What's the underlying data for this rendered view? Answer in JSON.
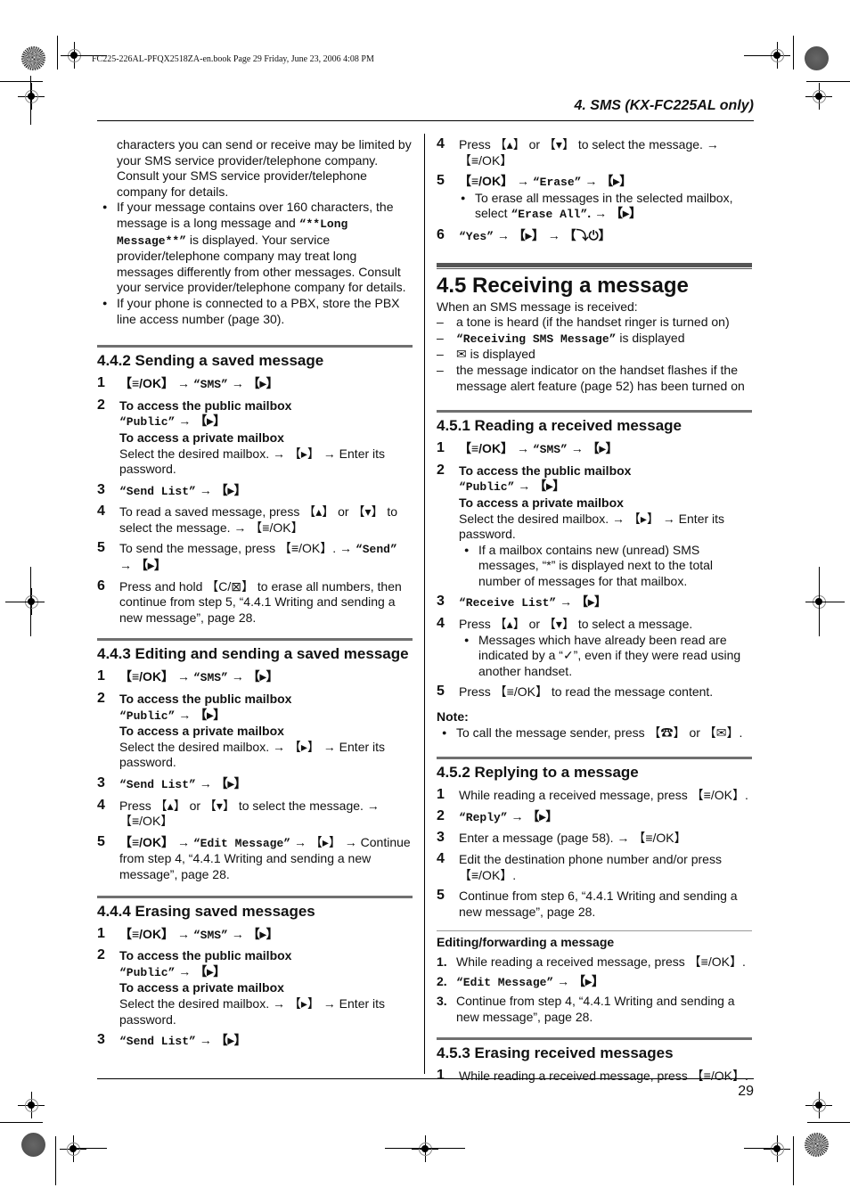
{
  "print_header": {
    "book_line": "FC225-226AL-PFQX2518ZA-en.book  Page 29  Friday, June 23, 2006  4:08 PM"
  },
  "running_header": {
    "title": "4. SMS (KX-FC225AL only)"
  },
  "footer": {
    "page_number": "29"
  },
  "icons": {
    "menu_ok": "menu-ok-key",
    "right": "right-key",
    "up": "up-key",
    "down": "down-key",
    "arrow": "arrow-right",
    "envelope": "envelope-icon",
    "off": "off-key",
    "talk": "talk-key",
    "speaker": "speakerphone-key",
    "clear": "clear-key"
  },
  "left": {
    "intro": {
      "para1": "characters you can send or receive may be limited by your SMS service provider/telephone company. Consult your SMS service provider/telephone company for details.",
      "bullet1_pre": "If your message contains over 160 characters, the message is a long message and ",
      "bullet1_code": "“**Long Message**”",
      "bullet1_post": " is displayed. Your service provider/telephone company may treat long messages differently from other messages. Consult your service provider/telephone company for details.",
      "bullet2": "If your phone is connected to a PBX, store the PBX line access number (page 30)."
    },
    "s442": {
      "title": "4.4.2 Sending a saved message",
      "steps": [
        {
          "n": "1",
          "a": "【≡/OK】 → ",
          "code": "“SMS”",
          "b": " → 【▸】"
        },
        {
          "n": "2",
          "pub_h": "To access the public mailbox",
          "pub_code": "“Public”",
          "pub_t": " → 【▸】",
          "priv_h": "To access a private mailbox",
          "priv_t": "Select the desired mailbox. → 【▸】 → Enter its password."
        },
        {
          "n": "3",
          "code": "“Send List”",
          "b": " → 【▸】"
        },
        {
          "n": "4",
          "text": "To read a saved message, press 【▴】 or 【▾】 to select the message. → 【≡/OK】"
        },
        {
          "n": "5",
          "a": "To send the message, press 【≡/OK】. → ",
          "code": "“Send”",
          "b": " → 【▸】"
        },
        {
          "n": "6",
          "text": "Press and hold 【C/⊠】 to erase all numbers, then continue from step 5, “4.4.1 Writing and sending a new message”, page 28."
        }
      ]
    },
    "s443": {
      "title": "4.4.3 Editing and sending a saved message",
      "steps": [
        {
          "n": "1",
          "a": "【≡/OK】 → ",
          "code": "“SMS”",
          "b": " → 【▸】"
        },
        {
          "n": "2",
          "pub_h": "To access the public mailbox",
          "pub_code": "“Public”",
          "pub_t": " → 【▸】",
          "priv_h": "To access a private mailbox",
          "priv_t": "Select the desired mailbox. → 【▸】 → Enter its password."
        },
        {
          "n": "3",
          "code": "“Send List”",
          "b": " → 【▸】"
        },
        {
          "n": "4",
          "text": "Press 【▴】 or 【▾】 to select the message. → 【≡/OK】"
        },
        {
          "n": "5",
          "a": "【≡/OK】 → ",
          "code": "“Edit Message”",
          "b": " → 【▸】 → Continue from step 4, “4.4.1 Writing and sending a new message”, page 28."
        }
      ]
    },
    "s444": {
      "title": "4.4.4 Erasing saved messages",
      "steps": [
        {
          "n": "1",
          "a": "【≡/OK】 → ",
          "code": "“SMS”",
          "b": " → 【▸】"
        },
        {
          "n": "2",
          "pub_h": "To access the public mailbox",
          "pub_code": "“Public”",
          "pub_t": " → 【▸】",
          "priv_h": "To access a private mailbox",
          "priv_t": "Select the desired mailbox. → 【▸】 → Enter its password."
        },
        {
          "n": "3",
          "code": "“Send List”",
          "b": " → 【▸】"
        }
      ]
    }
  },
  "right": {
    "cont": {
      "steps": [
        {
          "n": "4",
          "text": "Press 【▴】 or 【▾】 to select the message. → 【≡/OK】"
        },
        {
          "n": "5",
          "a": "【≡/OK】 → ",
          "code": "“Erase”",
          "b": " → 【▸】",
          "bullet_a": "To erase all messages in the selected mailbox, select ",
          "bullet_code": "“Erase All”",
          "bullet_b": ". → 【▸】"
        },
        {
          "n": "6",
          "code": "“Yes”",
          "b": " → 【▸】 → 【⤵⏻】"
        }
      ]
    },
    "s45": {
      "title": "4.5 Receiving a message",
      "intro": "When an SMS message is received:",
      "items": [
        {
          "text": "a tone is heard (if the handset ringer is turned on)"
        },
        {
          "code": "“Receiving SMS Message”",
          "text": " is displayed"
        },
        {
          "icon": "✉",
          "text": " is displayed"
        },
        {
          "text": "the message indicator on the handset flashes if the message alert feature (page 52) has been turned on"
        }
      ]
    },
    "s451": {
      "title": "4.5.1 Reading a received message",
      "steps": [
        {
          "n": "1",
          "a": "【≡/OK】 → ",
          "code": "“SMS”",
          "b": " → 【▸】"
        },
        {
          "n": "2",
          "pub_h": "To access the public mailbox",
          "pub_code": "“Public”",
          "pub_t": " → 【▸】",
          "priv_h": "To access a private mailbox",
          "priv_t": "Select the desired mailbox. → 【▸】 → Enter its password.",
          "bullet": "If a mailbox contains new (unread) SMS messages, “*” is displayed next to the total number of messages for that mailbox."
        },
        {
          "n": "3",
          "code": "“Receive List”",
          "b": " → 【▸】"
        },
        {
          "n": "4",
          "text": "Press 【▴】 or 【▾】 to select a message.",
          "bullet": "Messages which have already been read are indicated by a “✓”, even if they were read using another handset."
        },
        {
          "n": "5",
          "text": "Press 【≡/OK】 to read the message content."
        }
      ],
      "note_heading": "Note:",
      "note": "To call the message sender, press 【☎】 or 【✉】."
    },
    "s452": {
      "title": "4.5.2 Replying to a message",
      "steps": [
        {
          "n": "1",
          "text": "While reading a received message, press 【≡/OK】."
        },
        {
          "n": "2",
          "code": "“Reply”",
          "b": " → 【▸】"
        },
        {
          "n": "3",
          "text": "Enter a message (page 58). → 【≡/OK】"
        },
        {
          "n": "4",
          "text": "Edit the destination phone number and/or press 【≡/OK】."
        },
        {
          "n": "5",
          "text": "Continue from step 6, “4.4.1 Writing and sending a new message”, page 28."
        }
      ],
      "sub_title": "Editing/forwarding a message",
      "sub_steps": [
        {
          "n": "1.",
          "text": "While reading a received message, press 【≡/OK】."
        },
        {
          "n": "2.",
          "code": "“Edit Message”",
          "b": " → 【▸】"
        },
        {
          "n": "3.",
          "text": "Continue from step 4, “4.4.1 Writing and sending a new message”, page 28."
        }
      ]
    },
    "s453": {
      "title": "4.5.3 Erasing received messages",
      "steps": [
        {
          "n": "1",
          "text": "While reading a received message, press 【≡/OK】."
        }
      ]
    }
  }
}
